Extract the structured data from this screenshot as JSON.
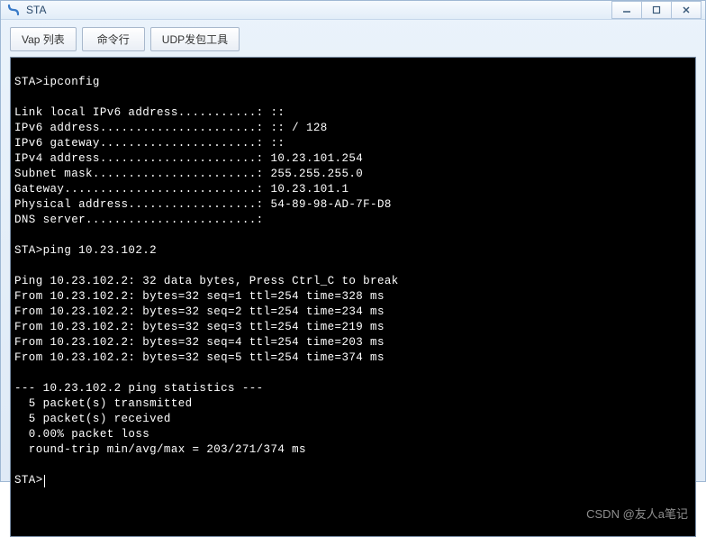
{
  "window": {
    "title": "STA"
  },
  "tabs": {
    "vap_list": "Vap 列表",
    "cli": "命令行",
    "udp_tool": "UDP发包工具"
  },
  "terminal": {
    "prompt": "STA>",
    "cmd_ipconfig": "ipconfig",
    "cmd_ping": "ping 10.23.102.2",
    "lines": {
      "blank": "",
      "l1": "Link local IPv6 address...........: ::",
      "l2": "IPv6 address......................: :: / 128",
      "l3": "IPv6 gateway......................: ::",
      "l4": "IPv4 address......................: 10.23.101.254",
      "l5": "Subnet mask.......................: 255.255.255.0",
      "l6": "Gateway...........................: 10.23.101.1",
      "l7": "Physical address..................: 54-89-98-AD-7F-D8",
      "l8": "DNS server........................:",
      "p0": "Ping 10.23.102.2: 32 data bytes, Press Ctrl_C to break",
      "p1": "From 10.23.102.2: bytes=32 seq=1 ttl=254 time=328 ms",
      "p2": "From 10.23.102.2: bytes=32 seq=2 ttl=254 time=234 ms",
      "p3": "From 10.23.102.2: bytes=32 seq=3 ttl=254 time=219 ms",
      "p4": "From 10.23.102.2: bytes=32 seq=4 ttl=254 time=203 ms",
      "p5": "From 10.23.102.2: bytes=32 seq=5 ttl=254 time=374 ms",
      "s0": "--- 10.23.102.2 ping statistics ---",
      "s1": "  5 packet(s) transmitted",
      "s2": "  5 packet(s) received",
      "s3": "  0.00% packet loss",
      "s4": "  round-trip min/avg/max = 203/271/374 ms"
    }
  },
  "watermark": "CSDN @友人a笔记"
}
